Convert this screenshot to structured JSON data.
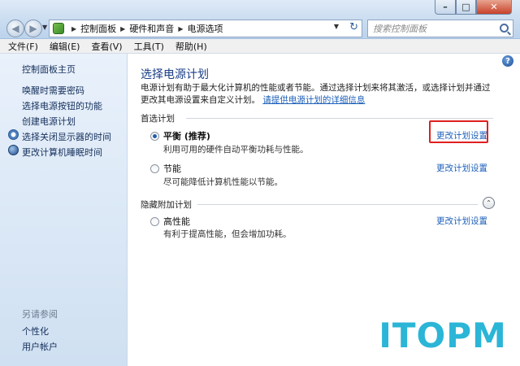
{
  "window": {
    "minimize": "–",
    "maximize": "□",
    "close": "✕"
  },
  "nav": {
    "back": "◀",
    "forward": "▶",
    "dropdown": "▼"
  },
  "address": {
    "crumbs": [
      "控制面板",
      "硬件和声音",
      "电源选项"
    ],
    "separator": "▶",
    "dropdown": "▼",
    "refresh": "↻"
  },
  "search": {
    "placeholder": "搜索控制面板"
  },
  "menu": {
    "items": [
      "文件(F)",
      "编辑(E)",
      "查看(V)",
      "工具(T)",
      "帮助(H)"
    ]
  },
  "sidebar": {
    "home": "控制面板主页",
    "links": [
      "唤醒时需要密码",
      "选择电源按钮的功能",
      "创建电源计划",
      "选择关闭显示器的时间",
      "更改计算机睡眠时间"
    ],
    "see_also_title": "另请参阅",
    "see_also": [
      "个性化",
      "用户帐户"
    ]
  },
  "main": {
    "help": "?",
    "title": "选择电源计划",
    "description": "电源计划有助于最大化计算机的性能或者节能。通过选择计划来将其激活，或选择计划并通过更改其电源设置来自定义计划。",
    "description_link": "请提供电源计划的详细信息",
    "preferred_group": "首选计划",
    "hidden_group": "隐藏附加计划",
    "collapse": "⌃",
    "plans": [
      {
        "name": "平衡 (推荐)",
        "desc": "利用可用的硬件自动平衡功耗与性能。",
        "link": "更改计划设置",
        "selected": true
      },
      {
        "name": "节能",
        "desc": "尽可能降低计算机性能以节能。",
        "link": "更改计划设置",
        "selected": false
      },
      {
        "name": "高性能",
        "desc": "有利于提高性能，但会增加功耗。",
        "link": "更改计划设置",
        "selected": false
      }
    ]
  },
  "watermark": "ITOPM"
}
